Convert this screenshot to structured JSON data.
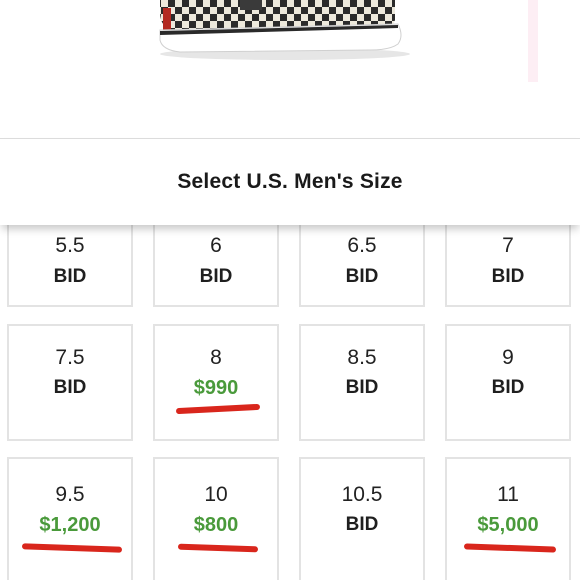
{
  "colors": {
    "bid_text": "#1f1f1f",
    "price_text": "#4a9a3b",
    "underline": "#d9261c",
    "cell_border": "#e3e3e3"
  },
  "product": {
    "image_icon": "checkerboard-sneaker"
  },
  "size_selector": {
    "title": "Select U.S. Men's Size",
    "sizes": [
      {
        "size": "5.5",
        "price": "BID",
        "has_price": false
      },
      {
        "size": "6",
        "price": "BID",
        "has_price": false
      },
      {
        "size": "6.5",
        "price": "BID",
        "has_price": false
      },
      {
        "size": "7",
        "price": "BID",
        "has_price": false
      },
      {
        "size": "7.5",
        "price": "BID",
        "has_price": false
      },
      {
        "size": "8",
        "price": "$990",
        "has_price": true
      },
      {
        "size": "8.5",
        "price": "BID",
        "has_price": false
      },
      {
        "size": "9",
        "price": "BID",
        "has_price": false
      },
      {
        "size": "9.5",
        "price": "$1,200",
        "has_price": true
      },
      {
        "size": "10",
        "price": "$800",
        "has_price": true
      },
      {
        "size": "10.5",
        "price": "BID",
        "has_price": false
      },
      {
        "size": "11",
        "price": "$5,000",
        "has_price": true
      }
    ]
  }
}
